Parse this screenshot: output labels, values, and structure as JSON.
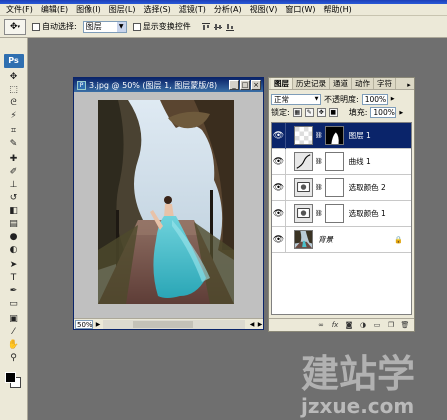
{
  "menu": {
    "items": [
      "文件(F)",
      "编辑(E)",
      "图像(I)",
      "图层(L)",
      "选择(S)",
      "滤镜(T)",
      "分析(A)",
      "视图(V)",
      "窗口(W)",
      "帮助(H)"
    ]
  },
  "options": {
    "auto_select_label": "自动选择:",
    "auto_select_value": "图层",
    "show_transform_label": "显示变换控件"
  },
  "toolbox": {
    "logo": "Ps",
    "tools": [
      "move-tool-icon",
      "marquee-tool-icon",
      "lasso-tool-icon",
      "magic-wand-icon",
      "crop-tool-icon",
      "slice-tool-icon",
      "healing-brush-icon",
      "brush-tool-icon",
      "clone-stamp-icon",
      "history-brush-icon",
      "eraser-tool-icon",
      "gradient-tool-icon",
      "blur-tool-icon",
      "dodge-tool-icon",
      "path-selection-icon",
      "type-tool-icon",
      "pen-tool-icon",
      "shape-tool-icon",
      "notes-tool-icon",
      "eyedropper-icon",
      "hand-tool-icon",
      "zoom-tool-icon"
    ],
    "foreground_color": "#000000",
    "background_color": "#ffffff"
  },
  "document": {
    "title": "3.jpg @ 50% (图层 1, 图层蒙版/8)",
    "zoom": "50%"
  },
  "layers_panel": {
    "tabs": [
      "图层",
      "历史记录",
      "通道",
      "动作",
      "字符"
    ],
    "active_tab": "图层",
    "blend_mode": "正常",
    "opacity_label": "不透明度:",
    "opacity_value": "100%",
    "lock_label": "锁定:",
    "fill_label": "填充:",
    "fill_value": "100%",
    "layers": [
      {
        "name": "图层 1",
        "type": "pixel-with-mask",
        "selected": true,
        "locked": false
      },
      {
        "name": "曲线 1",
        "type": "adjustment-curves",
        "selected": false,
        "locked": false
      },
      {
        "name": "选取颜色 2",
        "type": "adjustment-selective-color",
        "selected": false,
        "locked": false
      },
      {
        "name": "选取颜色 1",
        "type": "adjustment-selective-color",
        "selected": false,
        "locked": false
      },
      {
        "name": "背景",
        "type": "background",
        "selected": false,
        "locked": true
      }
    ],
    "bottom_icons": [
      "link-icon",
      "fx-icon",
      "mask-icon",
      "adjustment-icon",
      "group-icon",
      "new-layer-icon",
      "trash-icon"
    ]
  },
  "watermark": {
    "chinese": "建站学",
    "url": "jzxue.com"
  },
  "colors": {
    "workspace": "#6f6f6f",
    "chrome": "#ece9d8",
    "selection": "#0a246a"
  }
}
